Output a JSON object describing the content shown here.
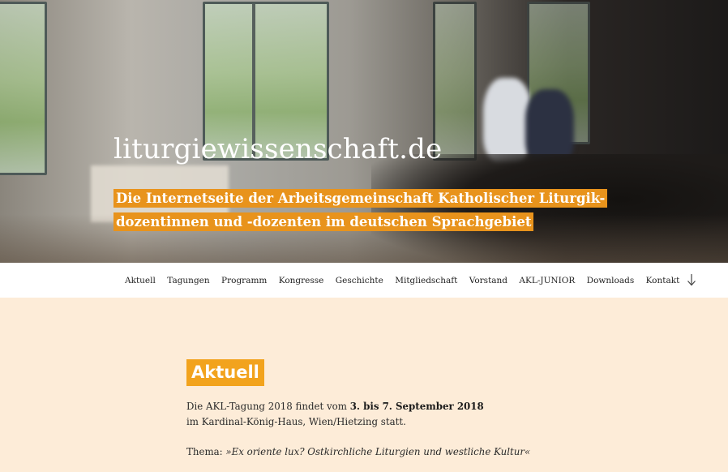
{
  "header": {
    "site_title": "liturgiewissenschaft.de",
    "tagline": "Die Internetseite der Arbeitsgemeinschaft Katholischer Liturgik-dozentinnen und -dozenten im deutschen Sprachgebiet",
    "tagline_line1": "Die Internetseite der Arbeitsgemeinschaft Katholischer Liturgik-",
    "tagline_line2": "dozentinnen und -dozenten im deutschen Sprachgebiet",
    "tagline_highlight_color": "#e8931c"
  },
  "nav": {
    "items": [
      {
        "label": "Aktuell"
      },
      {
        "label": "Tagungen"
      },
      {
        "label": "Programm"
      },
      {
        "label": "Kongresse"
      },
      {
        "label": "Geschichte"
      },
      {
        "label": "Mitgliedschaft"
      },
      {
        "label": "Vorstand"
      },
      {
        "label": "AKL-JUNIOR"
      },
      {
        "label": "Downloads"
      },
      {
        "label": "Kontakt"
      }
    ],
    "scroll_icon": "arrow-down-icon"
  },
  "main": {
    "heading": "Aktuell",
    "heading_color": "#f2a31d",
    "background_color": "#fdecd8",
    "para1": {
      "prefix": "Die AKL-Tagung 2018 findet vom ",
      "dates": "3. bis 7. September 2018",
      "suffix": " im Kardinal-König-Haus, Wien/Hietzing statt."
    },
    "para2": {
      "prefix": "Thema: ",
      "theme": "»Ex oriente lux? Ostkirchliche Liturgien und westliche Kultur«"
    }
  }
}
